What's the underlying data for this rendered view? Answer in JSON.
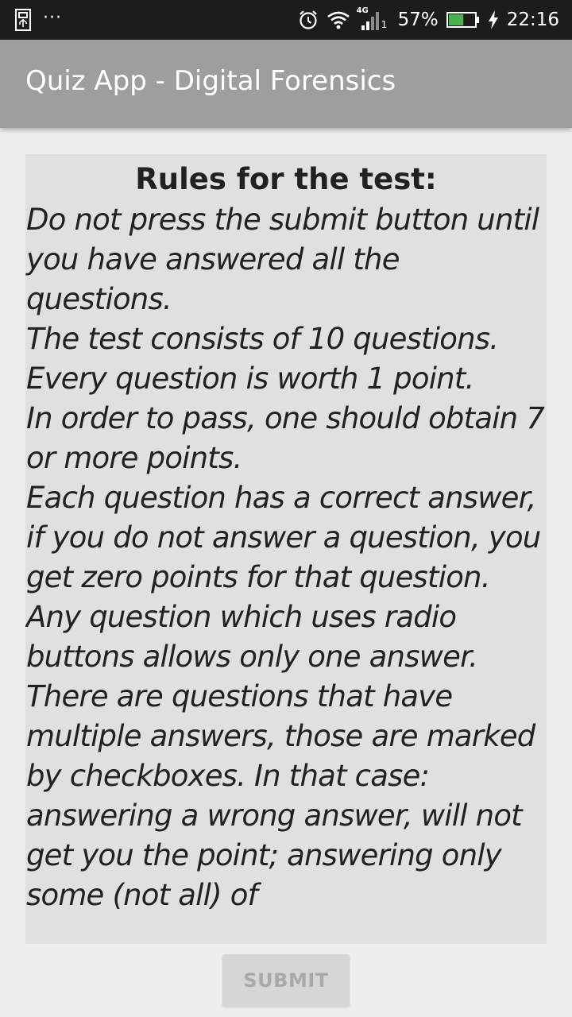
{
  "status_bar": {
    "notification_icons": [
      "usb-icon",
      "more-notifications-icon"
    ],
    "more_glyph": "···",
    "network_label": "4G",
    "sim_label": "1",
    "battery_percent": "57%",
    "battery_level": 0.57,
    "time": "22:16"
  },
  "app_bar": {
    "title": "Quiz App - Digital Forensics"
  },
  "rules": {
    "heading": "Rules for the test:",
    "lines": [
      "Do not press the submit button until you have answered all the questions.",
      "The test consists of 10 questions.",
      "Every question is worth 1 point.",
      "In order to pass, one should obtain 7 or more points.",
      "Each question has a correct answer, if you do not answer a question, you get zero points for that question.",
      "Any question which uses radio buttons allows only one answer.",
      "There are questions that have multiple answers, those are marked by checkboxes. In that case: answering a wrong answer, will not get you the point; answering only some (not all) of"
    ]
  },
  "submit": {
    "label": "SUBMIT",
    "enabled": false
  },
  "colors": {
    "status_bar_bg": "#1c1c1c",
    "app_bar_bg": "#9e9e9e",
    "page_bg": "#eeeeee",
    "card_bg": "#e0e0e0",
    "battery_fill": "#4caf50"
  }
}
